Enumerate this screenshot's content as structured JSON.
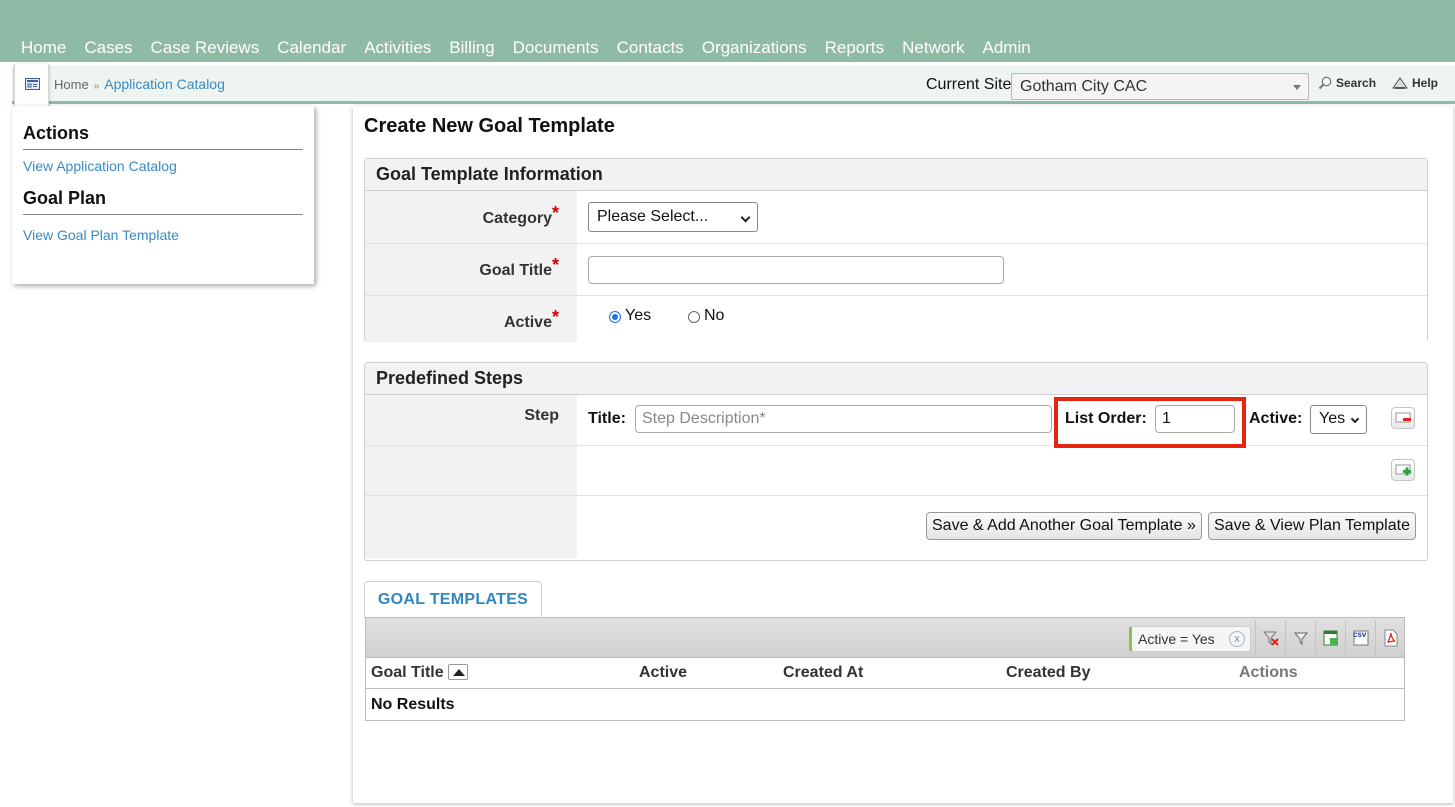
{
  "nav": {
    "items": [
      "Home",
      "Cases",
      "Case Reviews",
      "Calendar",
      "Activities",
      "Billing",
      "Documents",
      "Contacts",
      "Organizations",
      "Reports",
      "Network",
      "Admin"
    ]
  },
  "breadcrumb": {
    "home": "Home",
    "separator": "»",
    "current": "Application Catalog"
  },
  "site": {
    "label": "Current Site",
    "selected": "Gotham City CAC"
  },
  "topbar": {
    "search_label": "Search",
    "help_label": "Help"
  },
  "sidebar": {
    "actions_heading": "Actions",
    "actions_link": "View Application Catalog",
    "goal_plan_heading": "Goal Plan",
    "goal_plan_link": "View Goal Plan Template"
  },
  "page": {
    "title": "Create New Goal Template"
  },
  "goal_info": {
    "heading": "Goal Template Information",
    "category_label": "Category",
    "category_value": "Please Select...",
    "goal_title_label": "Goal Title",
    "goal_title_value": "",
    "active_label": "Active",
    "active_yes": "Yes",
    "active_no": "No",
    "required_mark": "*"
  },
  "steps": {
    "heading": "Predefined Steps",
    "step_label": "Step",
    "title_label": "Title:",
    "title_placeholder": "Step Description*",
    "list_order_label": "List Order:",
    "list_order_value": "1",
    "active_label": "Active:",
    "active_value": "Yes",
    "save_add_button": "Save & Add Another Goal Template »",
    "save_view_button": "Save & View Plan Template"
  },
  "grid": {
    "tab_label": "GOAL TEMPLATES",
    "filter_chip": "Active = Yes",
    "filter_clear": "x",
    "columns": [
      "Goal Title",
      "Active",
      "Created At",
      "Created By",
      "Actions"
    ],
    "empty_text": "No Results",
    "csv_label": "csv"
  },
  "colors": {
    "nav_bg": "#8fbba6",
    "link": "#3a8ac0",
    "highlight": "#e8230f",
    "required": "#d00000"
  }
}
